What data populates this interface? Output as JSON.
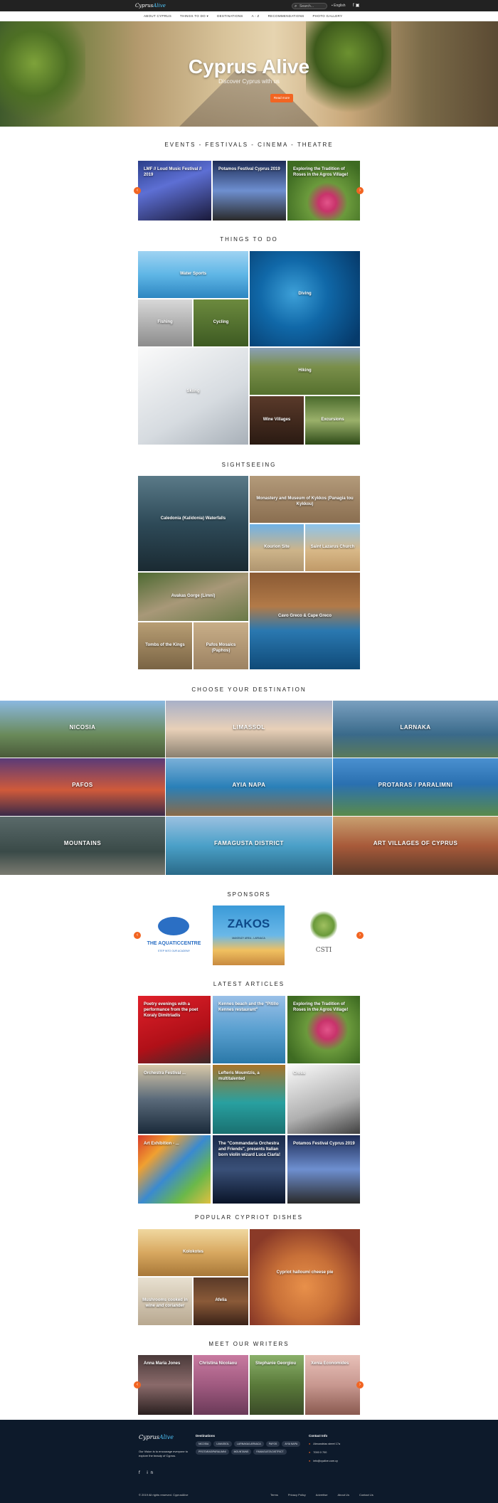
{
  "header": {
    "logo_main": "Cyprus",
    "logo_accent": "Alive",
    "search_placeholder": "Search...",
    "language": "English",
    "nav": [
      "ABOUT CYPRUS",
      "THINGS TO DO ▾",
      "DESTINATIONS",
      "A - Z",
      "RECOMMENDATIONS",
      "PHOTO GALLERY"
    ]
  },
  "hero": {
    "title": "Cyprus Alive",
    "subtitle": "Discover Cyprus with us",
    "button": "Read more"
  },
  "events": {
    "title": "EVENTS - FESTIVALS - CINEMA - THEATRE",
    "items": [
      "LMF // Loud Music Festival // 2019",
      "Potamos Festival Cyprus 2019",
      "Exploring the Tradition of Roses in the Agros Village!"
    ]
  },
  "things_to_do": {
    "title": "THINGS TO DO",
    "items": [
      "Water Sports",
      "Diving",
      "Fishing",
      "Cycling",
      "Skiing",
      "Hiking",
      "Wine Villages",
      "Excursions"
    ]
  },
  "sightseeing": {
    "title": "SIGHTSEEING",
    "items": [
      "Caledonia (Kalidonia) Waterfalls",
      "Monastery and Museum of Kykkos (Panagia tou Kykkou)",
      "Kourion Site",
      "Saint Lazarus Church",
      "Avakas Gorge (Limni)",
      "Cavo Greco & Cape Greco",
      "Tombs of the Kings",
      "Pafos Mosaics (Paphos)"
    ]
  },
  "destinations": {
    "title": "CHOOSE YOUR DESTINATION",
    "items": [
      "NICOSIA",
      "LIMASSOL",
      "LARNAKA",
      "PAFOS",
      "AYIA NAPA",
      "PROTARAS / PARALIMNI",
      "MOUNTAINS",
      "FAMAGUSTA DISTRICT",
      "ART VILLAGES OF CYPRUS"
    ]
  },
  "sponsors": {
    "title": "SPONSORS",
    "items": [
      {
        "name": "THE AQUATICCENTRE",
        "sub": "STEP INTO OUR ACADEMY"
      },
      {
        "name": "ZAKOS",
        "sub": "MAKENZY AREA - LARNACA"
      },
      {
        "name": "CSTI",
        "sub": ""
      }
    ]
  },
  "articles": {
    "title": "LATEST ARTICLES",
    "items": [
      "Poetry evenings with a performance from the poet Koraly Dimitriadis",
      "Kennes beach and the \"Pitillo Kennes restaurant\"",
      "Exploring the Tradition of Roses in the Agros Village!",
      "Orchestra Festival ...",
      "Lefteris Moumtzis, a multitalented",
      "Cross",
      "Art Exhibition - ...",
      "The \"Commandaria Orchestra and Friends\", presents Italian born violin wizard Luca Ciarla!",
      "Potamos Festival Cyprus 2019"
    ]
  },
  "dishes": {
    "title": "POPULAR CYPRIOT DISHES",
    "items": [
      "Kolokotes",
      "Cypriot halloumi cheese pie",
      "Mushrooms cooked in wine and coriander",
      "Afelia"
    ]
  },
  "writers": {
    "title": "MEET OUR WRITERS",
    "items": [
      "Anna Maria Jones",
      "Christina Nicolaou",
      "Stephanie Georgiou",
      "Xenia Economides"
    ]
  },
  "footer": {
    "logo_main": "Cyprus",
    "logo_accent": "Alive",
    "about": "Our Vision is to encourage everyone to explore the beauty of Cyprus.",
    "social": "f  in",
    "destinations_title": "Destinations",
    "destination_tags": [
      "NICOSIA",
      "LIMASSOL",
      "LARNAKA/LARNACA",
      "PAFOS",
      "AYIA NAPA",
      "PROTARAS/PARALIMNI",
      "MOUNTAINS",
      "FAMAGUSTA DISTRICT"
    ],
    "contact_title": "Contact Info",
    "address": "Alexandrias street 17a",
    "phone": "7000 0 700",
    "email": "info@cyalive.com.cy",
    "copyright": "© 2019 All rights reserved. CyprusAlive",
    "links": [
      "Terms",
      "Privacy Policy",
      "Advertise",
      "About Us",
      "Contact Us"
    ]
  }
}
